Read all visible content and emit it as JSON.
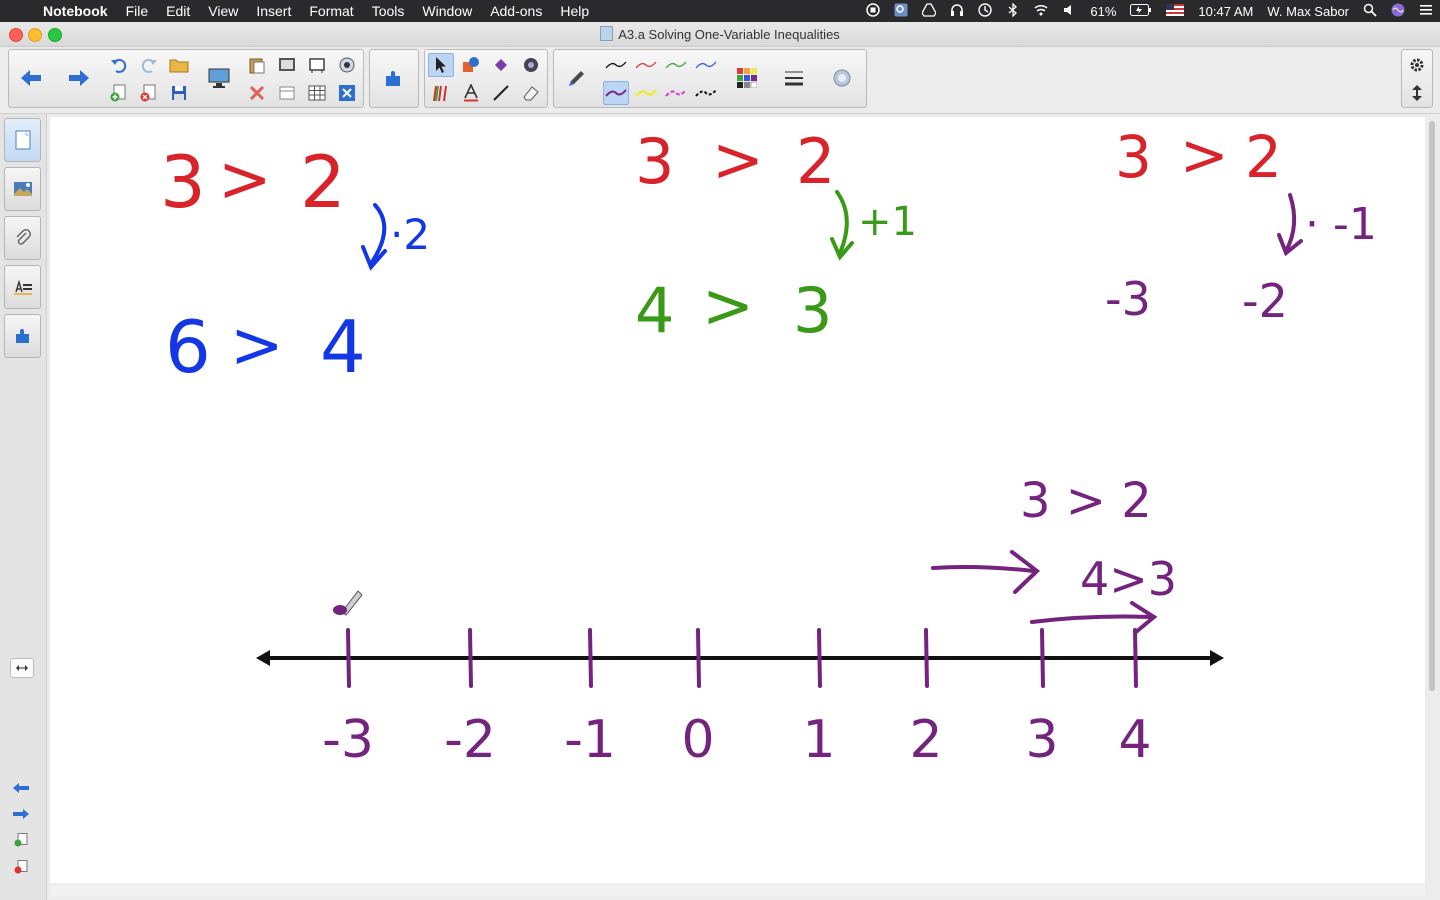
{
  "menubar": {
    "app_name": "Notebook",
    "items": [
      "File",
      "Edit",
      "View",
      "Insert",
      "Format",
      "Tools",
      "Window",
      "Add-ons",
      "Help"
    ],
    "battery": "61%",
    "time": "10:47 AM",
    "user": "W. Max Sabor"
  },
  "window": {
    "title": "A3.a Solving One-Variable Inequalities"
  },
  "colors": {
    "red": "#d8232a",
    "blue": "#1437e6",
    "green": "#3a9a18",
    "purple": "#74237f",
    "line": "#111111"
  },
  "canvas": {
    "example1": {
      "left": "3",
      "op": ">",
      "right": "2",
      "step": "·2",
      "res_left": "6",
      "res_op": ">",
      "res_right": "4"
    },
    "example2": {
      "left": "3",
      "op": ">",
      "right": "2",
      "step": "+1",
      "res_left": "4",
      "res_op": ">",
      "res_right": "3"
    },
    "example3": {
      "left": "3",
      "op": ">",
      "right": "2",
      "step": "· -1",
      "res_left": "-3",
      "res_right": "-2"
    },
    "number_line": {
      "labels": [
        "-3",
        "-2",
        "-1",
        "0",
        "1",
        "2",
        "3",
        "4"
      ],
      "note1": "3 > 2",
      "note2": "4>3"
    }
  },
  "icons": {
    "toolbar": [
      "back-arrow-icon",
      "forward-arrow-icon",
      "undo-icon",
      "redo-icon",
      "open-folder-icon",
      "add-page-icon",
      "delete-page-icon",
      "save-icon",
      "display-icon",
      "paste-icon",
      "delete-icon",
      "screen-shade-icon",
      "table-icon",
      "screen-capture-icon",
      "document-camera-icon",
      "clear-page-icon",
      "fullscreen-icon",
      "magic-pen-icon",
      "addons-icon",
      "select-icon",
      "shapes-icon",
      "fill-icon",
      "eraser-icon",
      "pens-icon",
      "text-icon",
      "line-icon",
      "pen-icon",
      "color-palette-icon",
      "line-style-icon",
      "properties-icon",
      "settings-icon",
      "move-toolbar-icon"
    ],
    "sidebar": [
      "page-sorter-icon",
      "gallery-icon",
      "attachments-icon",
      "properties-icon",
      "addons-icon"
    ]
  }
}
